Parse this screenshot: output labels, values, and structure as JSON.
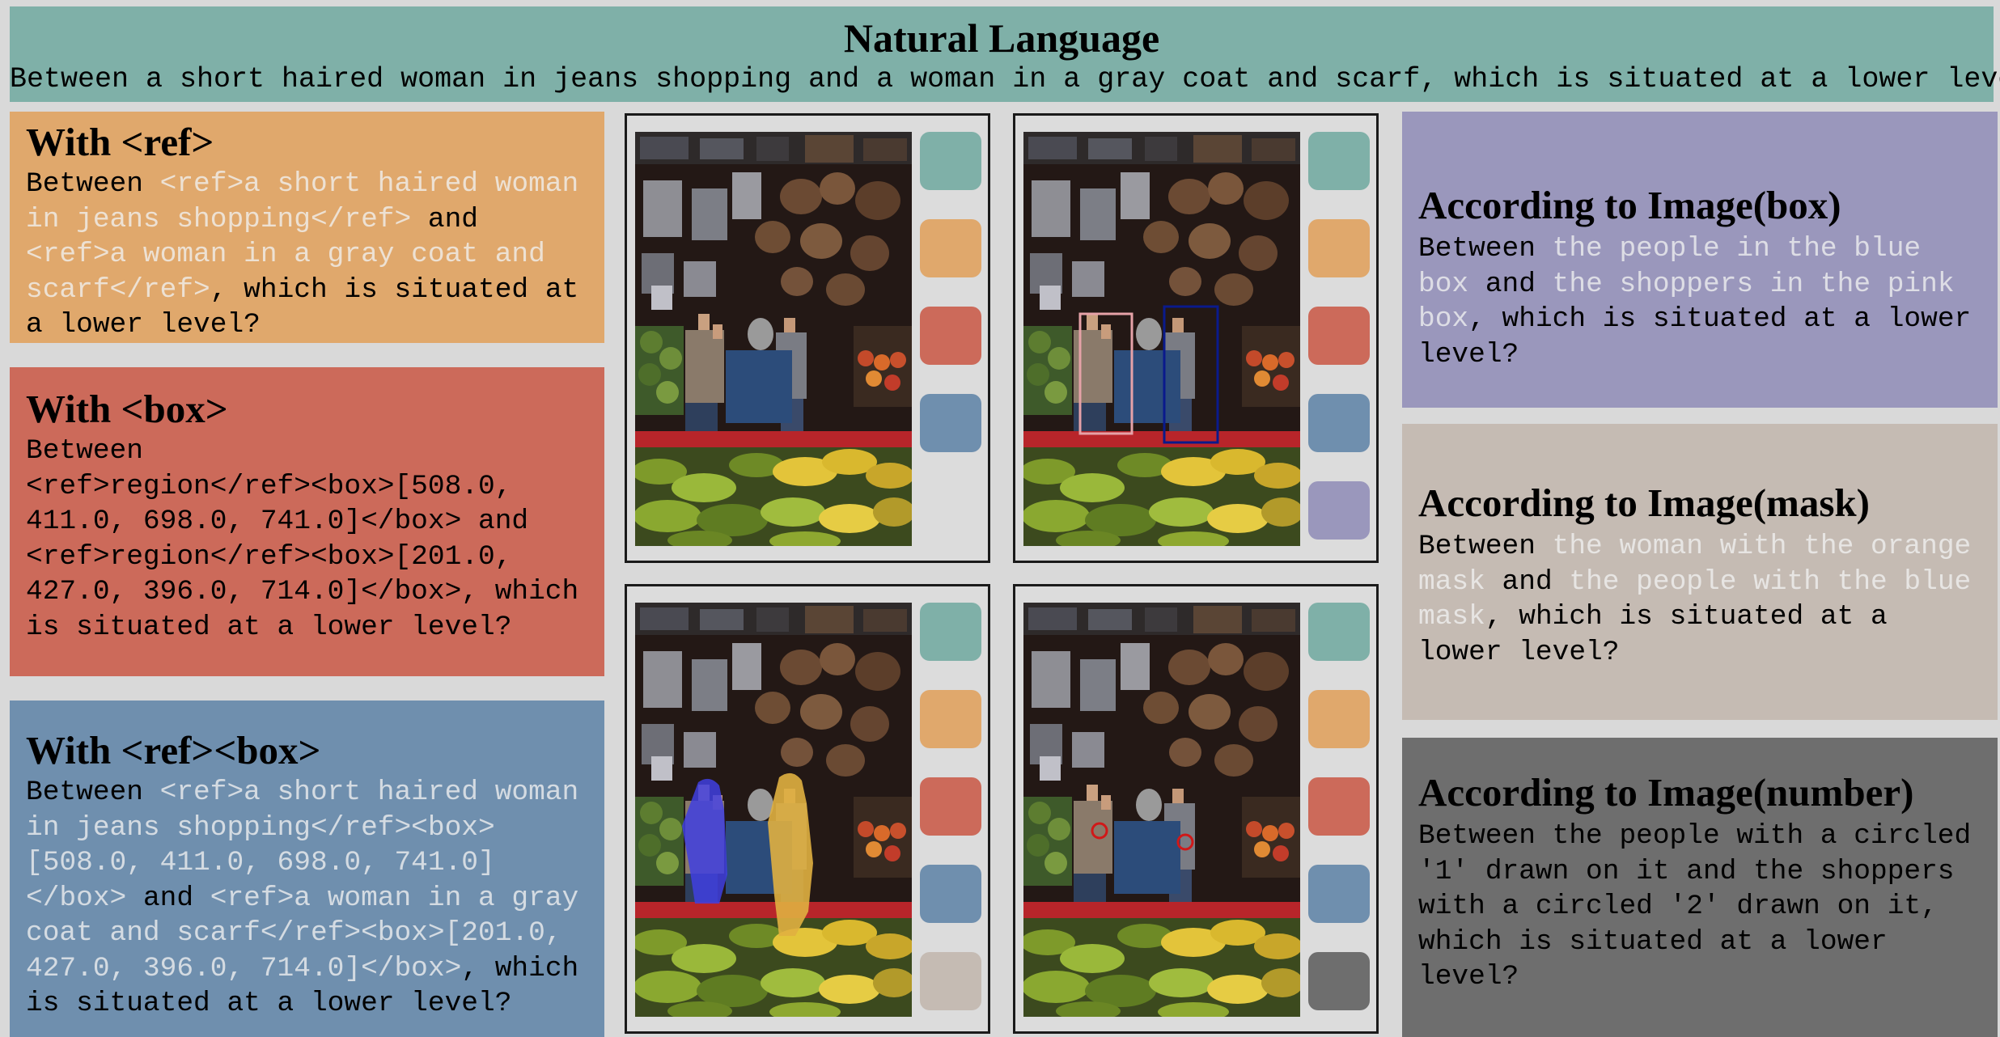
{
  "header": {
    "title": "Natural Language",
    "question": "Between a short haired woman in jeans shopping and a woman in a gray coat and scarf, which is situated at a lower level?"
  },
  "left": {
    "ref": {
      "title": "With <ref>",
      "t1": "Between ",
      "h1": "<ref>a short haired woman in jeans shopping</ref>",
      "t2": " and ",
      "h2": "<ref>a woman in a gray coat and scarf</ref>",
      "t3": ", which is situated at a lower level?"
    },
    "box": {
      "title": "With <box>",
      "text": "Between\n<ref>region</ref><box>[508.0,\n411.0, 698.0, 741.0]</box> and\n<ref>region</ref><box>[201.0,\n427.0, 396.0, 714.0]</box>, which\nis situated at a lower level?"
    },
    "refbox": {
      "title": "With <ref><box>",
      "t1": "Between ",
      "h1": "<ref>a short haired woman in jeans shopping</ref><box>[508.0, 411.0, 698.0, 741.0]</box>",
      "t2": " and ",
      "h2": "<ref>a woman in a gray coat and scarf</ref><box>[201.0, 427.0, 396.0, 714.0]</box>",
      "t3": ", which is situated at a lower level?"
    }
  },
  "right": {
    "ibox": {
      "title": "According to Image(box)",
      "t1": "Between ",
      "h1": "the people in the blue box",
      "t2": " and ",
      "h2": "the shoppers in the pink box",
      "t3": ", which is situated at a lower level?"
    },
    "imask": {
      "title": "According to Image(mask)",
      "t1": "Between ",
      "h1": "the woman with the orange mask",
      "t2": " and ",
      "h2": "the people with the blue mask",
      "t3": ", which is situated at a lower level?"
    },
    "inum": {
      "title": "According to Image(number)",
      "text": "Between the people with a circled '1' drawn on it and the shoppers with a circled '2' drawn on it, which is situated at a lower level?"
    }
  },
  "colors": {
    "teal": "#7fb0a8",
    "orange": "#e0a86c",
    "red": "#cc6a5a",
    "blue": "#6f8fae",
    "lavender": "#9a97bc",
    "beige": "#c5bbb3",
    "gray": "#6e6e6e"
  },
  "panels": {
    "tl": {
      "chips": [
        "teal",
        "orange",
        "red",
        "blue"
      ]
    },
    "tr": {
      "chips": [
        "teal",
        "orange",
        "red",
        "blue",
        "lavender"
      ]
    },
    "bl": {
      "chips": [
        "teal",
        "orange",
        "red",
        "blue",
        "beige"
      ]
    },
    "br": {
      "chips": [
        "teal",
        "orange",
        "red",
        "blue",
        "gray"
      ]
    }
  }
}
